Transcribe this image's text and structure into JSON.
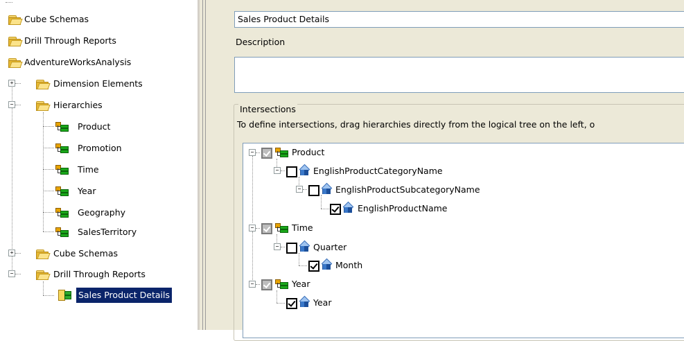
{
  "left_tree": {
    "items": [
      {
        "label": "Cube Schemas"
      },
      {
        "label": "Drill Through Reports"
      },
      {
        "label": "AdventureWorksAnalysis"
      },
      {
        "label": "Dimension Elements"
      },
      {
        "label": "Hierarchies"
      },
      {
        "label": "Product"
      },
      {
        "label": "Promotion"
      },
      {
        "label": "Time"
      },
      {
        "label": "Year"
      },
      {
        "label": "Geography"
      },
      {
        "label": "SalesTerritory"
      },
      {
        "label": "Cube Schemas"
      },
      {
        "label": "Drill Through Reports"
      },
      {
        "label": "Sales Product Details"
      }
    ],
    "expander_plus": "+",
    "expander_minus": "−"
  },
  "form": {
    "name_value": "Sales Product Details",
    "description_label": "Description",
    "description_value": "",
    "intersections_label": "Intersections",
    "intersections_help": "To define intersections, drag hierarchies directly from the logical tree on the left, o"
  },
  "intersections_tree": [
    {
      "label": "Product",
      "state": "partial"
    },
    {
      "label": "EnglishProductCategoryName",
      "state": "unchecked"
    },
    {
      "label": "EnglishProductSubcategoryName",
      "state": "unchecked"
    },
    {
      "label": "EnglishProductName",
      "state": "checked"
    },
    {
      "label": "Time",
      "state": "partial"
    },
    {
      "label": "Quarter",
      "state": "unchecked"
    },
    {
      "label": "Month",
      "state": "checked"
    },
    {
      "label": "Year",
      "state": "partial"
    },
    {
      "label": "Year",
      "state": "checked"
    }
  ],
  "colors": {
    "selection": "#0a246a",
    "panel_bg": "#ece9d8",
    "field_border": "#7f9db9"
  }
}
